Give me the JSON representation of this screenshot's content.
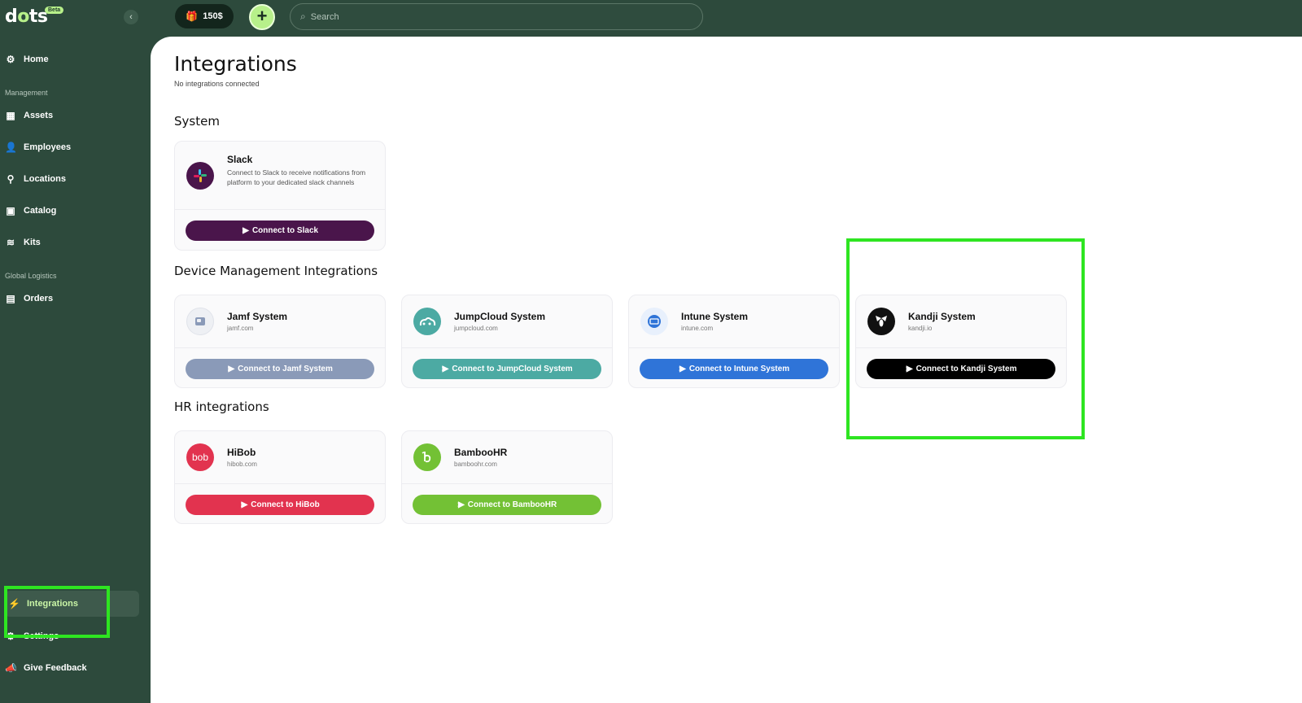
{
  "topbar": {
    "logo_text": "d",
    "logo_dot": "o",
    "logo_rest": "ts",
    "beta": "Beta",
    "credit": "150$",
    "search_placeholder": "Search"
  },
  "sidebar": {
    "home": "Home",
    "section_management": "Management",
    "assets": "Assets",
    "employees": "Employees",
    "locations": "Locations",
    "catalog": "Catalog",
    "kits": "Kits",
    "section_logistics": "Global Logistics",
    "orders": "Orders",
    "integrations": "Integrations",
    "settings": "Settings",
    "feedback": "Give Feedback"
  },
  "page": {
    "title": "Integrations",
    "subtitle": "No integrations connected"
  },
  "sections": {
    "system": "System",
    "device": "Device Management Integrations",
    "hr": "HR integrations"
  },
  "cards": {
    "slack": {
      "name": "Slack",
      "desc": "Connect to Slack to receive notifications from platform to your dedicated slack channels",
      "button": "Connect to Slack"
    },
    "jamf": {
      "name": "Jamf System",
      "domain": "jamf.com",
      "button": "Connect to Jamf System"
    },
    "jumpcloud": {
      "name": "JumpCloud System",
      "domain": "jumpcloud.com",
      "button": "Connect to JumpCloud System"
    },
    "intune": {
      "name": "Intune System",
      "domain": "intune.com",
      "button": "Connect to Intune System"
    },
    "kandji": {
      "name": "Kandji System",
      "domain": "kandji.io",
      "button": "Connect to Kandji System"
    },
    "hibob": {
      "name": "HiBob",
      "domain": "hibob.com",
      "button": "Connect to HiBob",
      "logo": "bob"
    },
    "bamboohr": {
      "name": "BambooHR",
      "domain": "bamboohr.com",
      "button": "Connect to BambooHR"
    }
  },
  "colors": {
    "sidebar_bg": "#2d4a3c",
    "accent": "#b7f08a",
    "slack": "#4a154b",
    "jamf": "#8a9ab8",
    "jumpcloud": "#4caaa3",
    "intune": "#2f74d8",
    "kandji": "#000000",
    "hibob": "#e2334f",
    "bamboohr": "#73c135",
    "highlight": "#2ee521"
  }
}
